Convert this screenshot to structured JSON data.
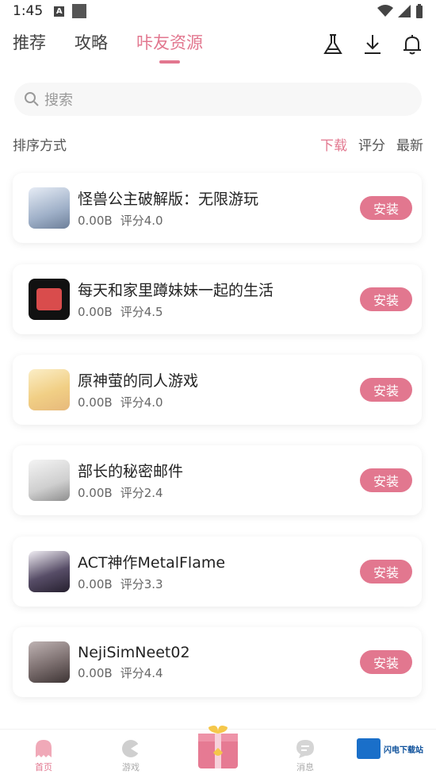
{
  "status": {
    "time": "1:45",
    "a_badge": "A"
  },
  "nav": {
    "tabs": [
      "推荐",
      "攻略",
      "咔友资源"
    ],
    "active_tab": 2
  },
  "search": {
    "placeholder": "搜索"
  },
  "sort": {
    "label": "排序方式",
    "options": [
      "下载",
      "评分",
      "最新"
    ],
    "active": 0
  },
  "apps": [
    {
      "title": "怪兽公主破解版：无限游玩",
      "size": "0.00B",
      "rating": "评分4.0",
      "button": "安装",
      "thumb_color": "#b9c6d8"
    },
    {
      "title": "每天和家里蹲妹妹一起的生活",
      "size": "0.00B",
      "rating": "评分4.5",
      "button": "安装",
      "thumb_color": "#d44a4a"
    },
    {
      "title": "原神萤的同人游戏",
      "size": "0.00B",
      "rating": "评分4.0",
      "button": "安装",
      "thumb_color": "#f3d79a"
    },
    {
      "title": "部长的秘密邮件",
      "size": "0.00B",
      "rating": "评分2.4",
      "button": "安装",
      "thumb_color": "#cfcfcf"
    },
    {
      "title": "ACT神作MetalFlame",
      "size": "0.00B",
      "rating": "评分3.3",
      "button": "安装",
      "thumb_color": "#3a3346"
    },
    {
      "title": "NejiSimNeet02",
      "size": "0.00B",
      "rating": "评分4.4",
      "button": "安装",
      "thumb_color": "#8d7f7f"
    }
  ],
  "bottom": {
    "items": [
      "首页",
      "游戏",
      "",
      "消息",
      ""
    ],
    "active": 0
  },
  "watermark": {
    "text": "闪电下载站"
  },
  "colors": {
    "accent": "#e2778f"
  }
}
